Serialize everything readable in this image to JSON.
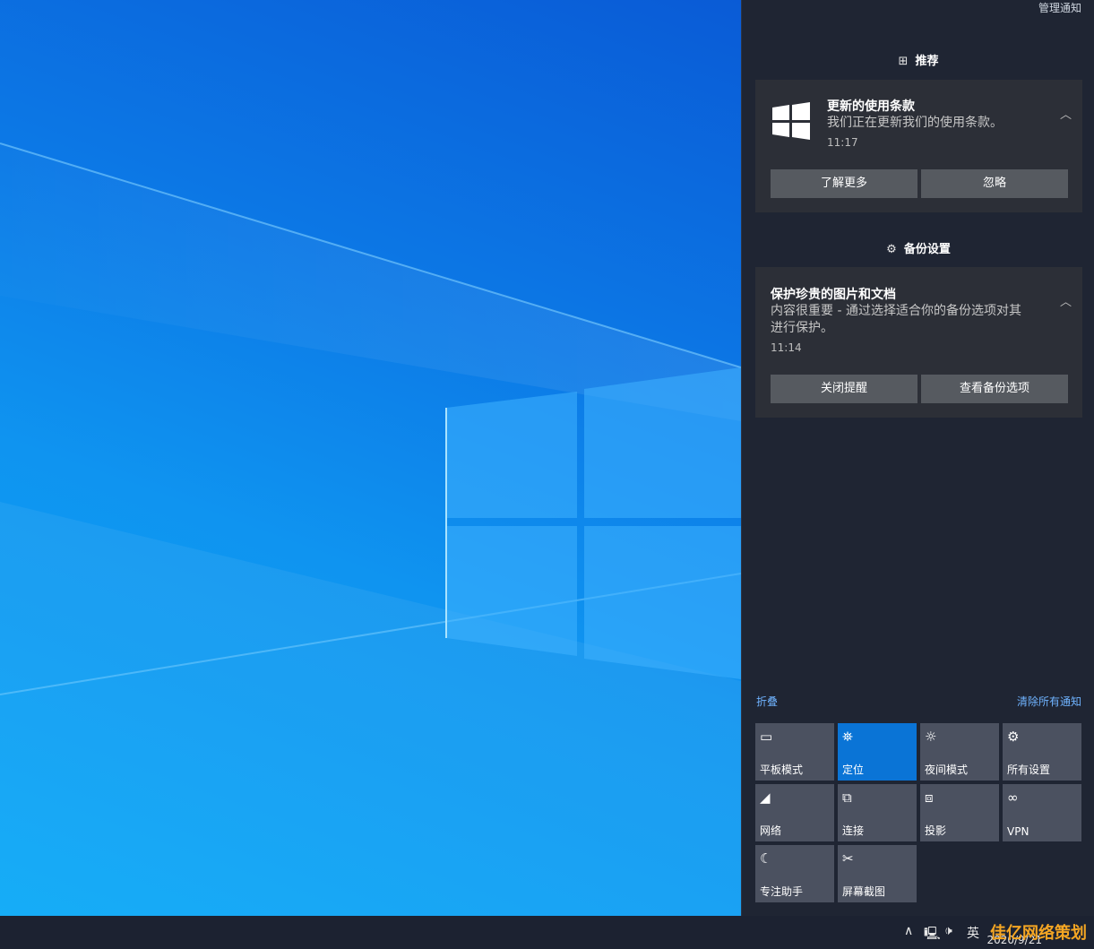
{
  "action_center": {
    "manage_label": "管理通知",
    "groups": [
      {
        "header": "推荐",
        "icon": "app-tile-icon",
        "title": "更新的使用条款",
        "body": "我们正在更新我们的使用条款。",
        "time": "11:17",
        "buttons": [
          "了解更多",
          "忽略"
        ]
      },
      {
        "header": "备份设置",
        "icon": "gear-icon",
        "title": "保护珍贵的图片和文档",
        "body_line1": "内容很重要 - 通过选择适合你的备份选项对其",
        "body_line2": "进行保护。",
        "time": "11:14",
        "buttons": [
          "关闭提醒",
          "查看备份选项"
        ]
      }
    ],
    "collapse_label": "折叠",
    "clear_all_label": "清除所有通知",
    "quick_actions": [
      {
        "label": "平板模式",
        "icon": "tablet-mode-icon",
        "active": false
      },
      {
        "label": "定位",
        "icon": "location-icon",
        "active": true
      },
      {
        "label": "夜间模式",
        "icon": "night-light-icon",
        "active": false
      },
      {
        "label": "所有设置",
        "icon": "settings-gear-icon",
        "active": false
      },
      {
        "label": "网络",
        "icon": "network-icon",
        "active": false
      },
      {
        "label": "连接",
        "icon": "connect-icon",
        "active": false
      },
      {
        "label": "投影",
        "icon": "project-icon",
        "active": false
      },
      {
        "label": "VPN",
        "icon": "vpn-icon",
        "active": false
      },
      {
        "label": "专注助手",
        "icon": "focus-assist-moon-icon",
        "active": false
      },
      {
        "label": "屏幕截图",
        "icon": "screen-snip-icon",
        "active": false
      }
    ]
  },
  "taskbar": {
    "language": "英",
    "date": "2020/9/21",
    "watermark": "佳亿网络策划"
  },
  "colors": {
    "accent": "#0a74d6",
    "panel_bg": "#1f2533",
    "card_bg": "#2c2f37",
    "link": "#6fb3ff"
  }
}
